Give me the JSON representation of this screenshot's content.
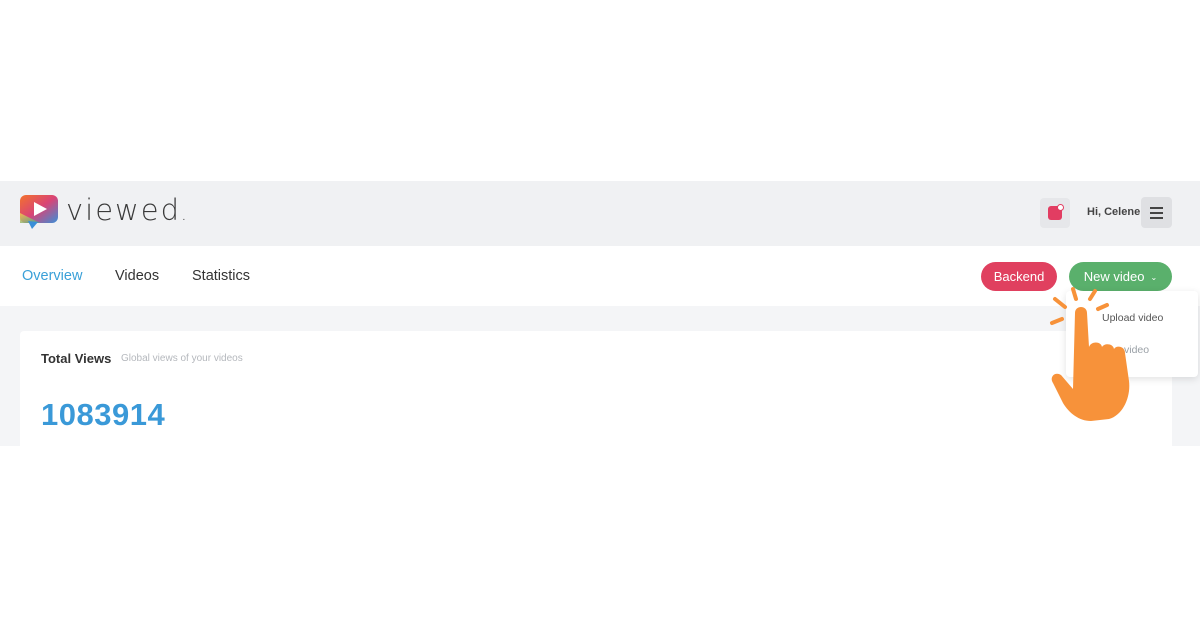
{
  "brand": {
    "name": "viewed",
    "name_suffix": "."
  },
  "header": {
    "greeting": "Hi, Celene",
    "notification_icon": "notification-icon",
    "menu_icon": "hamburger-menu-icon"
  },
  "nav": {
    "tabs": [
      {
        "label": "Overview",
        "active": true
      },
      {
        "label": "Videos",
        "active": false
      },
      {
        "label": "Statistics",
        "active": false
      }
    ],
    "backend_label": "Backend",
    "new_video_label": "New video"
  },
  "dropdown": {
    "items": [
      "Upload video",
      "video"
    ]
  },
  "card": {
    "title": "Total Views",
    "subtitle": "Global views of your videos",
    "value": "1083914"
  },
  "colors": {
    "accent_blue": "#3a99d8",
    "backend_red": "#e0405f",
    "new_video_green": "#5ab06c",
    "hand_orange": "#f7923a"
  }
}
